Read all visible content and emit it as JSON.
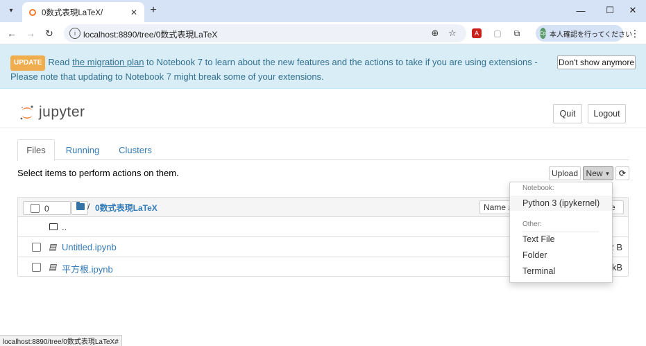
{
  "browser": {
    "tab_title": "0数式表現LaTeX/",
    "url": "localhost:8890/tree/0数式表現LaTeX",
    "profile_label": "本人確認を行ってください",
    "profile_initials": "Cp",
    "status_url": "localhost:8890/tree/0数式表現LaTeX#"
  },
  "banner": {
    "badge": "UPDATE",
    "text_before": "Read ",
    "link": "the migration plan",
    "text_after": " to Notebook 7 to learn about the new features and the actions to take if you are using extensions - Please note that updating to Notebook 7 might break some of your extensions.",
    "dismiss_label": "Don't show anymore"
  },
  "header": {
    "logo_text": "jupyter",
    "quit_label": "Quit",
    "logout_label": "Logout"
  },
  "tabs": [
    {
      "label": "Files",
      "active": true
    },
    {
      "label": "Running",
      "active": false
    },
    {
      "label": "Clusters",
      "active": false
    }
  ],
  "toolbar": {
    "hint": "Select items to perform actions on them.",
    "upload_label": "Upload",
    "new_label": "New"
  },
  "filelist": {
    "selected_count": "0",
    "crumb_root": "/",
    "crumb_dir": "0数式表現LaTeX",
    "sort_name_label": "Name",
    "sort_size_label": "ze",
    "rows": [
      {
        "name": "..",
        "size": ""
      },
      {
        "name": "Untitled.ipynb",
        "size": "2 B"
      },
      {
        "name": "平方根.ipynb",
        "size": "kB"
      }
    ]
  },
  "new_menu": {
    "notebook_header": "Notebook:",
    "python_kernel": "Python 3 (ipykernel)",
    "other_header": "Other:",
    "text_file": "Text File",
    "folder": "Folder",
    "terminal": "Terminal"
  },
  "colors": {
    "banner_bg": "#d9edf7",
    "banner_text": "#31708f",
    "badge": "#f0ad4e",
    "link": "#337ab7",
    "jupyter_orange": "#f37726",
    "chrome_bg": "#d6e2f5"
  }
}
